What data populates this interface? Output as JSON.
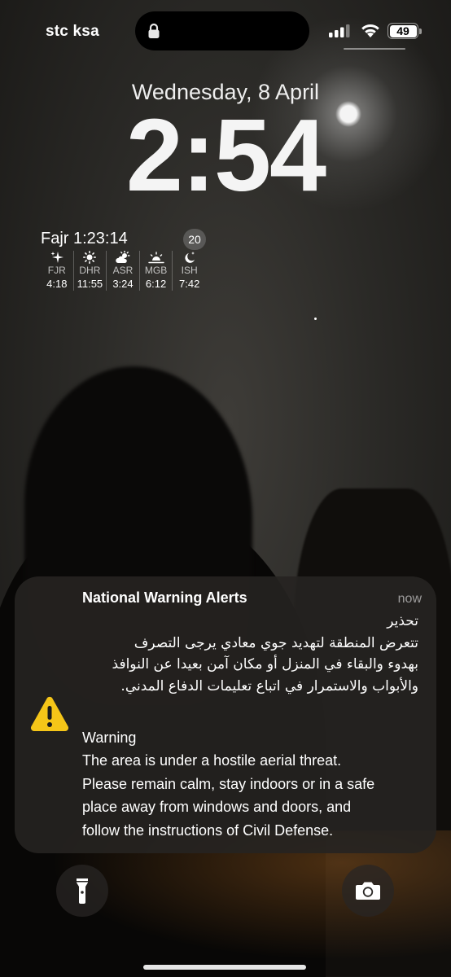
{
  "status_bar": {
    "carrier": "stc ksa",
    "battery_level": "49",
    "icons": [
      "lock-icon",
      "cellular-signal-icon",
      "wifi-icon",
      "battery-icon"
    ]
  },
  "lock_screen": {
    "date": "Wednesday, 8 April",
    "time": "2:54"
  },
  "prayer_widget": {
    "next_prayer": "Fajr 1:23:14",
    "badge": "20",
    "prayers": [
      {
        "name": "FJR",
        "time": "4:18",
        "icon": "sparkle-icon"
      },
      {
        "name": "DHR",
        "time": "11:55",
        "icon": "sun-icon"
      },
      {
        "name": "ASR",
        "time": "3:24",
        "icon": "sun-cloud-icon"
      },
      {
        "name": "MGB",
        "time": "6:12",
        "icon": "sunset-icon"
      },
      {
        "name": "ISH",
        "time": "7:42",
        "icon": "moon-stars-icon"
      }
    ]
  },
  "notification": {
    "app": "National Warning Alerts",
    "time": "now",
    "icon": "warning-triangle-icon",
    "arabic_lines": [
      "تحذير",
      "تتعرض المنطقة لتهديد جوي معادي يرجى التصرف",
      "بهدوء والبقاء في المنزل أو مكان آمن بعيدا عن النوافذ",
      "والأبواب والاستمرار في اتباع تعليمات الدفاع المدني."
    ],
    "english_lines": [
      "Warning",
      "The area is under a hostile aerial threat.",
      "Please remain calm, stay indoors or in a safe",
      "place away from windows and doors, and",
      "follow the instructions of Civil Defense."
    ]
  },
  "quick_actions": {
    "left": "flashlight-icon",
    "right": "camera-icon"
  },
  "colors": {
    "warning_yellow": "#F5C518",
    "notification_bg": "#262421"
  }
}
